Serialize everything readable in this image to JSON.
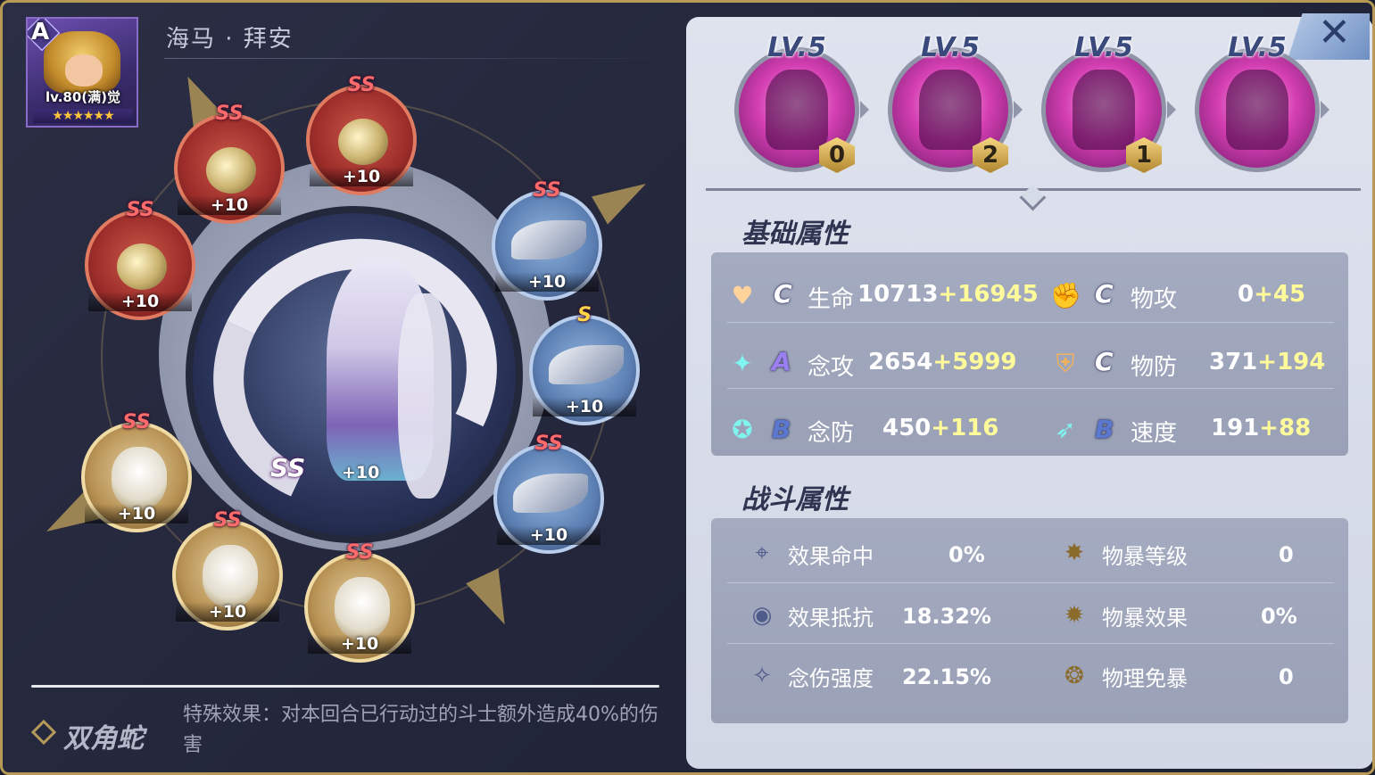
{
  "hero": {
    "name": "海马 · 拜安",
    "grade": "A",
    "level": "lv.80(满)觉",
    "stars": "★★★★★★"
  },
  "center_rune": {
    "grade": "SS",
    "bonus": "+10"
  },
  "runes": [
    {
      "grade": "SS",
      "bonus": "+10",
      "type": "red"
    },
    {
      "grade": "SS",
      "bonus": "+10",
      "type": "red"
    },
    {
      "grade": "SS",
      "bonus": "+10",
      "type": "red"
    },
    {
      "grade": "SS",
      "bonus": "+10",
      "type": "blue"
    },
    {
      "grade": "S",
      "bonus": "+10",
      "type": "blue"
    },
    {
      "grade": "SS",
      "bonus": "+10",
      "type": "blue"
    },
    {
      "grade": "SS",
      "bonus": "+10",
      "type": "gold"
    },
    {
      "grade": "SS",
      "bonus": "+10",
      "type": "gold"
    },
    {
      "grade": "SS",
      "bonus": "+10",
      "type": "gold"
    }
  ],
  "set_effect": {
    "name": "双角蛇",
    "description": "特殊效果：对本回合已行动过的斗士额外造成40%的伤害"
  },
  "skills": [
    {
      "level": "LV.5",
      "count": "0"
    },
    {
      "level": "LV.5",
      "count": "2"
    },
    {
      "level": "LV.5",
      "count": "1"
    },
    {
      "level": "LV.5",
      "count": ""
    }
  ],
  "close_label": "✕",
  "basic_title": "基础属性",
  "basic_stats": [
    {
      "icon": "heart-icon",
      "glyph": "♥",
      "grade": "C",
      "label": "生命",
      "base": "10713",
      "plus": "+16945"
    },
    {
      "icon": "fist-icon",
      "glyph": "✊",
      "grade": "C",
      "label": "物攻",
      "base": "0",
      "plus": "+45"
    },
    {
      "icon": "sparkle-icon",
      "glyph": "✦",
      "grade": "A",
      "label": "念攻",
      "base": "2654",
      "plus": "+5999"
    },
    {
      "icon": "shield-icon",
      "glyph": "⛨",
      "grade": "C",
      "label": "物防",
      "base": "371",
      "plus": "+194"
    },
    {
      "icon": "crest-icon",
      "glyph": "✪",
      "grade": "B",
      "label": "念防",
      "base": "450",
      "plus": "+116"
    },
    {
      "icon": "wing-icon",
      "glyph": "➶",
      "grade": "B",
      "label": "速度",
      "base": "191",
      "plus": "+88"
    }
  ],
  "combat_title": "战斗属性",
  "combat_stats": [
    {
      "icon": "crosshair-icon",
      "glyph": "⌖",
      "label": "效果命中",
      "value": "0%"
    },
    {
      "icon": "burst-icon",
      "glyph": "✸",
      "label": "物暴等级",
      "value": "0"
    },
    {
      "icon": "shield-ring-icon",
      "glyph": "◉",
      "label": "效果抵抗",
      "value": "18.32%"
    },
    {
      "icon": "spiky-burst-icon",
      "glyph": "✹",
      "label": "物暴效果",
      "value": "0%"
    },
    {
      "icon": "star-sparkle-icon",
      "glyph": "✧",
      "label": "念伤强度",
      "value": "22.15%"
    },
    {
      "icon": "crit-shield-icon",
      "glyph": "❂",
      "label": "物理免暴",
      "value": "0"
    }
  ],
  "colors": {
    "panel_border": "#b79a55",
    "stat_plus": "#fffb9a",
    "box_bg": "#a4abc0"
  }
}
